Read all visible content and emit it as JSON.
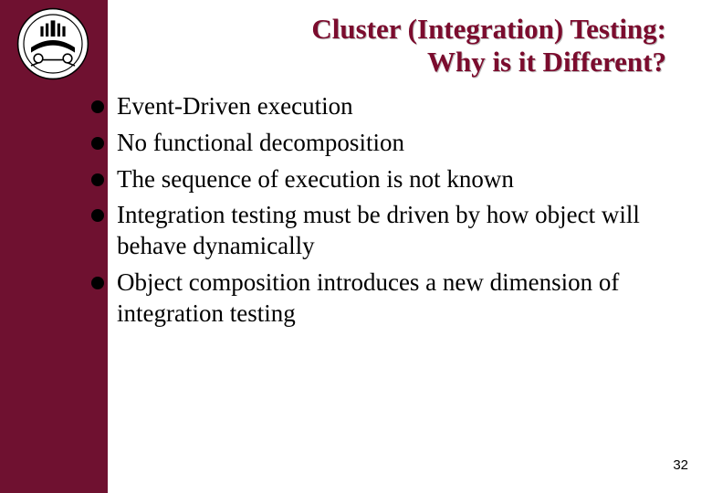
{
  "title_line1": "Cluster (Integration) Testing:",
  "title_line2": "Why is it Different?",
  "bullets": [
    "Event-Driven execution",
    "No functional decomposition",
    "The sequence of execution is not known",
    "Integration testing must be driven by how object will behave dynamically",
    "Object composition introduces a new dimension of integration testing"
  ],
  "page_number": "32",
  "colors": {
    "sidebar": "#6f1130",
    "title": "#7b0c2e"
  }
}
